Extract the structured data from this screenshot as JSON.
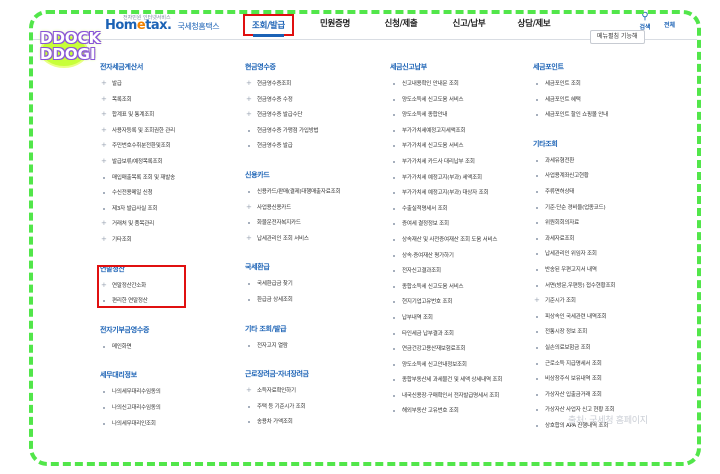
{
  "badge": {
    "line1": "DDOCK",
    "line2": "DDOGI"
  },
  "header": {
    "logo_small": "전자민원 인터넷서비스",
    "logo_brand_a": "Hom",
    "logo_brand_b": "e",
    "logo_brand_c": "tax.",
    "logo_org": "국세청홈택스",
    "nav": [
      "조회/발급",
      "민원증명",
      "신청/제출",
      "신고/납부",
      "상담/제보"
    ],
    "search_label": "검색",
    "allmenu_label": "전체",
    "menu_btn": "메뉴펼침 기능해"
  },
  "columns": [
    {
      "sections": [
        {
          "title": "전자세금계산서",
          "items": [
            {
              "t": "발급",
              "plus": true
            },
            {
              "t": "목록조회",
              "plus": true
            },
            {
              "t": "합계표 및 통계조회",
              "plus": true
            },
            {
              "t": "사용자등록 및 조회권한 관리",
              "plus": true
            },
            {
              "t": "주민번호수취분전환및조회",
              "plus": true
            },
            {
              "t": "발급보류/예정목록조회",
              "plus": true
            },
            {
              "t": "매입매출목록 조회 및 재발송",
              "plus": false
            },
            {
              "t": "수신전용메일 신청",
              "plus": false
            },
            {
              "t": "제3자 발급사실 조회",
              "plus": false
            },
            {
              "t": "거래처 및 품목관리",
              "plus": true
            },
            {
              "t": "기타조회",
              "plus": true
            }
          ]
        },
        {
          "title": "연말정산",
          "items": [
            {
              "t": "연말정산간소화",
              "plus": true
            },
            {
              "t": "편리한 연말정산",
              "plus": false
            }
          ]
        },
        {
          "title": "전자기부금영수증",
          "items": [
            {
              "t": "메인화면",
              "plus": false
            }
          ]
        },
        {
          "title": "세무대리정보",
          "items": [
            {
              "t": "나의세무대리수임동의",
              "plus": false
            },
            {
              "t": "나의신고대리수임동의",
              "plus": false
            },
            {
              "t": "나의세무대리인조회",
              "plus": false
            }
          ]
        }
      ]
    },
    {
      "sections": [
        {
          "title": "현금영수증",
          "items": [
            {
              "t": "현금영수증조회",
              "plus": true
            },
            {
              "t": "현금영수증 수정",
              "plus": true
            },
            {
              "t": "현금영수증 발급수단",
              "plus": true
            },
            {
              "t": "현금영수증 가맹점 가입방법",
              "plus": false
            },
            {
              "t": "현금영수증 발급",
              "plus": false
            }
          ]
        },
        {
          "title": "신용카드",
          "items": [
            {
              "t": "신용카드/판매(결제)대행매출자료조회",
              "plus": false
            },
            {
              "t": "사업용신용카드",
              "plus": true
            },
            {
              "t": "화물운전자복지카드",
              "plus": false
            },
            {
              "t": "납세관리인 조회 서비스",
              "plus": true
            }
          ]
        },
        {
          "title": "국세환급",
          "items": [
            {
              "t": "국세환급금 찾기",
              "plus": false
            },
            {
              "t": "환급금 상세조회",
              "plus": false
            }
          ]
        },
        {
          "title": "기타 조회/발급",
          "items": [
            {
              "t": "전자고지 열람",
              "plus": false
            }
          ]
        },
        {
          "title": "근로장려금·자녀장려금",
          "items": [
            {
              "t": "소득자료확인하기",
              "plus": true
            },
            {
              "t": "주택 등 기준시가 조회",
              "plus": false
            },
            {
              "t": "송용차 가액조회",
              "plus": false
            }
          ]
        }
      ]
    },
    {
      "sections": [
        {
          "title": "세금신고납부",
          "items": [
            {
              "t": "신고내용확인 안내문 조회",
              "plus": false
            },
            {
              "t": "양도소득세 신고도움 서비스",
              "plus": false
            },
            {
              "t": "양도소득세 종합안내",
              "plus": false
            },
            {
              "t": "부가가치세예정고지세액조회",
              "plus": false
            },
            {
              "t": "부가가치세 신고도움 서비스",
              "plus": false
            },
            {
              "t": "부가가치세 카드사 대리납부 조회",
              "plus": false
            },
            {
              "t": "부가가치세 예정고지(부과) 세액조회",
              "plus": false
            },
            {
              "t": "부가가치세 예정고지(부과) 대상자 조회",
              "plus": false
            },
            {
              "t": "수출실적명세서 조회",
              "plus": false
            },
            {
              "t": "증여세 결정정보 조회",
              "plus": false
            },
            {
              "t": "상속재산 및 사전증여재산 조회 도움 서비스",
              "plus": false
            },
            {
              "t": "상속·증여재산 평가하기",
              "plus": false
            },
            {
              "t": "전자신고결과조회",
              "plus": false
            },
            {
              "t": "종합소득세 신고도움 서비스",
              "plus": false
            },
            {
              "t": "현지기업고유번호 조회",
              "plus": false
            },
            {
              "t": "납부내역 조회",
              "plus": false
            },
            {
              "t": "타인세금 납부결과 조회",
              "plus": false
            },
            {
              "t": "연금건강고용산재보험료조회",
              "plus": false
            },
            {
              "t": "양도소득세 신고안내정보조회",
              "plus": false
            },
            {
              "t": "종합부동산세 과세물건 및 세액 상세내역 조회",
              "plus": false
            },
            {
              "t": "내국신용장·구매확인서 전자발급명세서 조회",
              "plus": false
            },
            {
              "t": "해외부동산 고유번호 조회",
              "plus": false
            }
          ]
        }
      ]
    },
    {
      "sections": [
        {
          "title": "세금포인트",
          "items": [
            {
              "t": "세금포인트 조회",
              "plus": false
            },
            {
              "t": "세금포인트 혜택",
              "plus": false
            },
            {
              "t": "세금포인트 할인 쇼핑몰 안내",
              "plus": false
            }
          ]
        },
        {
          "title": "기타조회",
          "items": [
            {
              "t": "과세유형전환",
              "plus": false
            },
            {
              "t": "사업용계좌신고현황",
              "plus": false
            },
            {
              "t": "주류면허상태",
              "plus": false
            },
            {
              "t": "기준·단순 경비율(업종코드)",
              "plus": false
            },
            {
              "t": "위원회회의자료",
              "plus": false
            },
            {
              "t": "과세자료조회",
              "plus": false
            },
            {
              "t": "납세관리인 위임자 조회",
              "plus": false
            },
            {
              "t": "반송된 우편고지서 내역",
              "plus": false
            },
            {
              "t": "서면(방문,우편등) 접수현황조회",
              "plus": false
            },
            {
              "t": "기준시가 조회",
              "plus": true
            },
            {
              "t": "피상속인 국세관련 내역조회",
              "plus": false
            },
            {
              "t": "전통시장 정보 조회",
              "plus": false
            },
            {
              "t": "실손의료보험금 조회",
              "plus": false
            },
            {
              "t": "근로소득 지급명세서 조회",
              "plus": false
            },
            {
              "t": "비상장주식 보유내역 조회",
              "plus": false
            },
            {
              "t": "가상자산 입출금거래 조회",
              "plus": false
            },
            {
              "t": "가상자산 사업자 신고 현황 조회",
              "plus": false
            },
            {
              "t": "상호합의 APA 진행내역 조회",
              "plus": false
            }
          ]
        }
      ]
    }
  ],
  "watermark": "출처: 국세청 홈페이지"
}
